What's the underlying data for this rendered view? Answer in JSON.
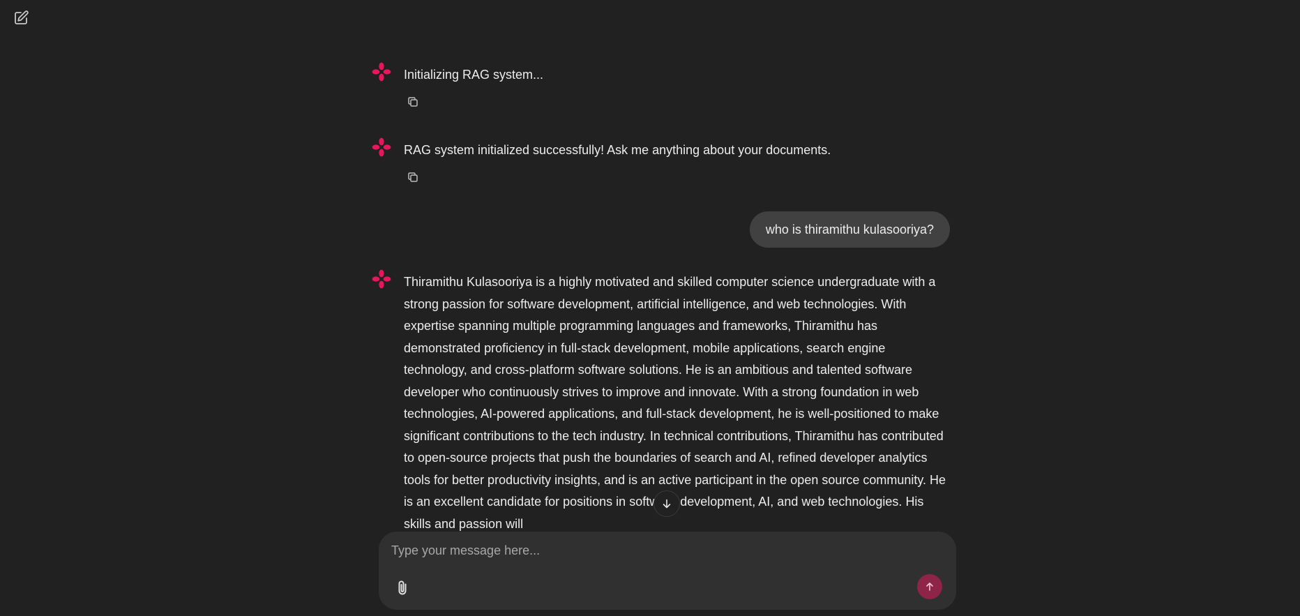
{
  "colors": {
    "background": "#212121",
    "composer": "#303030",
    "user_bubble": "#414141",
    "accent": "#e8175d",
    "send_button": "#8e2448"
  },
  "header": {
    "new_chat_icon": "edit-square-icon"
  },
  "messages": [
    {
      "role": "assistant",
      "icon": "app-logo-icon",
      "text": "Initializing RAG system...",
      "copy_icon": "copy-icon"
    },
    {
      "role": "assistant",
      "icon": "app-logo-icon",
      "text": "RAG system initialized successfully! Ask me anything about your documents.",
      "copy_icon": "copy-icon"
    },
    {
      "role": "user",
      "text": "who is thiramithu kulasooriya?"
    },
    {
      "role": "assistant",
      "icon": "app-logo-icon",
      "text": "Thiramithu Kulasooriya is a highly motivated and skilled computer science undergraduate with a strong passion for software development, artificial intelligence, and web technologies. With expertise spanning multiple programming languages and frameworks, Thiramithu has demonstrated proficiency in full-stack development, mobile applications, search engine technology, and cross-platform software solutions. He is an ambitious and talented software developer who continuously strives to improve and innovate. With a strong foundation in web technologies, AI-powered applications, and full-stack development, he is well-positioned to make significant contributions to the tech industry. In technical contributions, Thiramithu has contributed to open-source projects that push the boundaries of search and AI, refined developer analytics tools for better productivity insights, and is an active participant in the open source community. He is an excellent candidate for positions in software development, AI, and web technologies. His skills and passion will"
    }
  ],
  "scroll_down_icon": "arrow-down-icon",
  "composer": {
    "placeholder": "Type your message here...",
    "attach_icon": "paperclip-icon",
    "send_icon": "arrow-up-icon"
  }
}
